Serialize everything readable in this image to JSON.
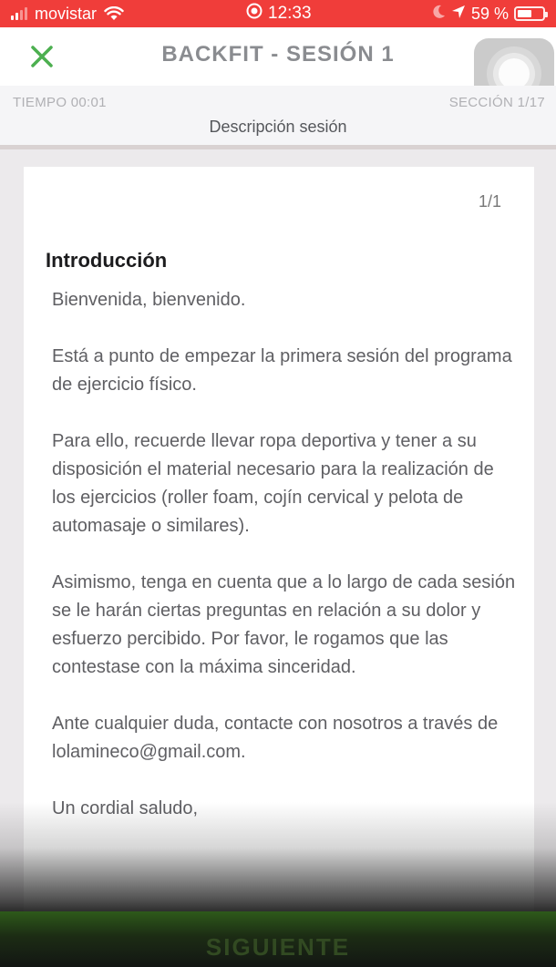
{
  "status_bar": {
    "carrier": "movistar",
    "time": "12:33",
    "battery": "59 %",
    "battery_level": 0.59,
    "signal_bars": 2,
    "icons": [
      "signal-icon",
      "wifi-icon",
      "alarm-icon",
      "moon-icon",
      "location-arrow-icon",
      "battery-icon"
    ]
  },
  "header": {
    "title": "BACKFIT - SESIÓN 1",
    "close_icon": "close-icon",
    "accent_color": "#4caf50"
  },
  "subheader": {
    "time": "TIEMPO 00:01",
    "section": "SECCIÓN 1/17",
    "description": "Descripción sesión"
  },
  "card": {
    "page_counter": "1/1",
    "heading": "Introducción",
    "paragraphs": [
      "Bienvenida, bienvenido.",
      "Está a punto de empezar la primera sesión del programa de ejercicio físico.",
      "Para ello, recuerde llevar ropa deportiva y tener a su disposición el material necesario para la realización de los ejercicios (roller foam, cojín cervical y pelota de automasaje o similares).",
      "Asimismo, tenga en cuenta que a lo largo de cada sesión se le harán ciertas preguntas en relación a su dolor y esfuerzo percibido. Por favor, le rogamos que las contestase con la máxima sinceridad.",
      "Ante cualquier duda, contacte con nosotros a través de lolamineco@gmail.com.",
      "Un cordial saludo,"
    ]
  },
  "footer": {
    "next_label": "SIGUIENTE"
  },
  "colors": {
    "status_bar": "#f03d3a",
    "button_green": "#2e5a1a"
  }
}
